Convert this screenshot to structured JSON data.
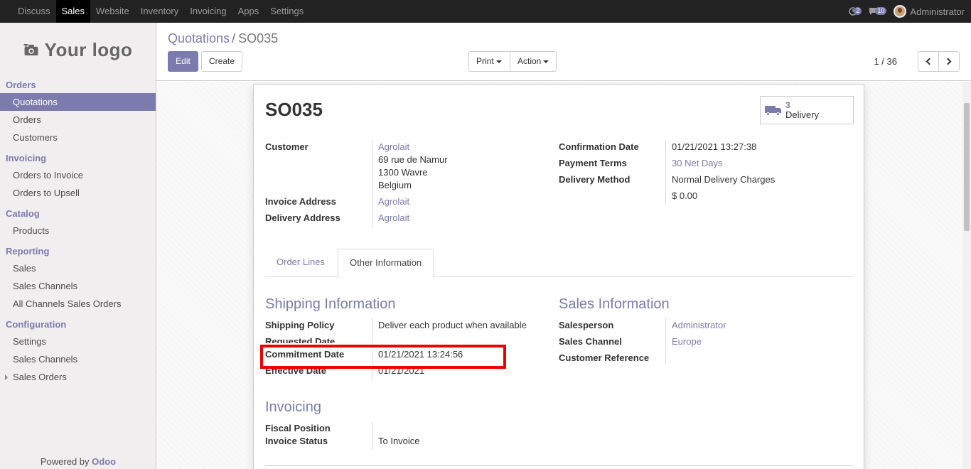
{
  "topbar": {
    "menu": [
      "Discuss",
      "Sales",
      "Website",
      "Inventory",
      "Invoicing",
      "Apps",
      "Settings"
    ],
    "active": "Sales",
    "activity_count": "2",
    "messages_count": "10",
    "user": "Administrator"
  },
  "sidebar": {
    "logo": "Your logo",
    "sections": {
      "orders": "Orders",
      "invoicing": "Invoicing",
      "catalog": "Catalog",
      "reporting": "Reporting",
      "configuration": "Configuration"
    },
    "items": {
      "quotations": "Quotations",
      "orders": "Orders",
      "customers": "Customers",
      "orders_to_invoice": "Orders to Invoice",
      "orders_to_upsell": "Orders to Upsell",
      "products": "Products",
      "sales": "Sales",
      "sales_channels": "Sales Channels",
      "all_channels": "All Channels Sales Orders",
      "settings": "Settings",
      "cfg_sales_channels": "Sales Channels",
      "sales_orders": "Sales Orders"
    },
    "powered_by": "Powered by",
    "powered_brand": "Odoo"
  },
  "control_panel": {
    "breadcrumb_parent": "Quotations",
    "breadcrumb_sep": "/",
    "breadcrumb_current": "SO035",
    "edit": "Edit",
    "create": "Create",
    "print": "Print",
    "action": "Action",
    "pager": "1 / 36"
  },
  "form": {
    "title": "SO035",
    "delivery_count": "3",
    "delivery_label": "Delivery",
    "customer_label": "Customer",
    "customer_name": "Agrolait",
    "customer_addr1": "69 rue de Namur",
    "customer_addr2": "1300 Wavre",
    "customer_addr3": "Belgium",
    "invoice_address_label": "Invoice Address",
    "invoice_address": "Agrolait",
    "delivery_address_label": "Delivery Address",
    "delivery_address": "Agrolait",
    "confirmation_date_label": "Confirmation Date",
    "confirmation_date": "01/21/2021 13:27:38",
    "payment_terms_label": "Payment Terms",
    "payment_terms": "30 Net Days",
    "delivery_method_label": "Delivery Method",
    "delivery_method": "Normal Delivery Charges",
    "delivery_price": "$ 0.00",
    "tab_order_lines": "Order Lines",
    "tab_other_info": "Other Information",
    "shipping_title": "Shipping Information",
    "shipping_policy_label": "Shipping Policy",
    "shipping_policy": "Deliver each product when available",
    "requested_date_label": "Requested Date",
    "commitment_date_label": "Commitment Date",
    "commitment_date": "01/21/2021 13:24:56",
    "effective_date_label": "Effective Date",
    "effective_date": "01/21/2021",
    "sales_info_title": "Sales Information",
    "salesperson_label": "Salesperson",
    "salesperson": "Administrator",
    "sales_channel_label": "Sales Channel",
    "sales_channel": "Europe",
    "customer_ref_label": "Customer Reference",
    "invoicing_title": "Invoicing",
    "fiscal_position_label": "Fiscal Position",
    "invoice_status_label": "Invoice Status",
    "invoice_status": "To Invoice"
  },
  "colors": {
    "accent": "#7c7bad",
    "highlight": "#ee0000"
  }
}
